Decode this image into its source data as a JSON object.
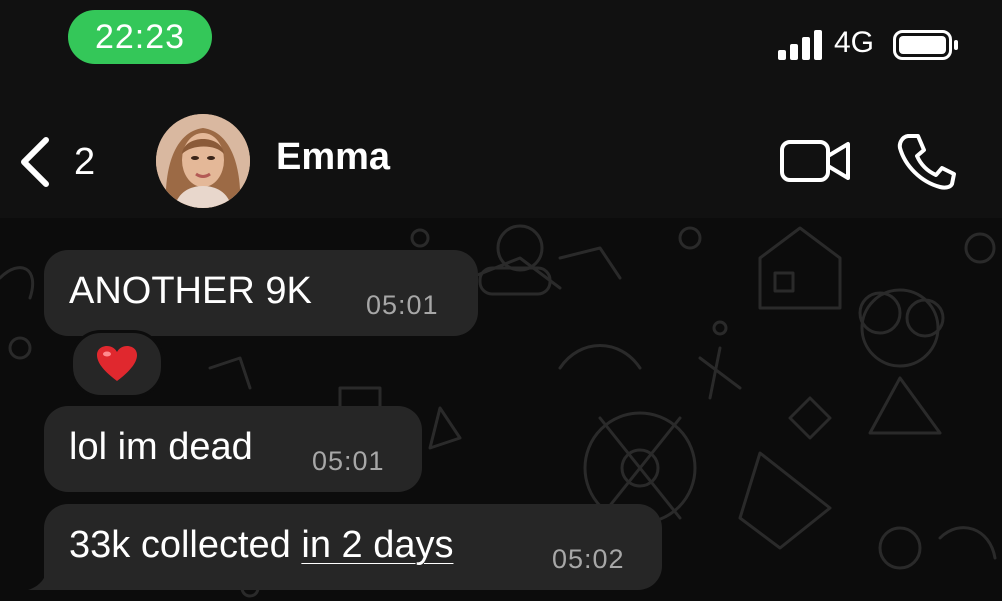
{
  "status_bar": {
    "time": "22:23",
    "network": "4G",
    "signal_bars": 4,
    "icons": [
      "signal-icon",
      "battery-icon"
    ],
    "pill_color": "#34c759"
  },
  "header": {
    "back_count": "2",
    "contact_name": "Emma",
    "icons": [
      "back-chevron-icon",
      "video-camera-icon",
      "phone-icon"
    ]
  },
  "messages": [
    {
      "text": "ANOTHER 9K",
      "time": "05:01",
      "reaction": "❤️"
    },
    {
      "text": "lol im dead",
      "time": "05:01"
    },
    {
      "text_prefix": "33k collected ",
      "link_text": "in 2 days",
      "time": "05:02"
    }
  ],
  "colors": {
    "background": "#0b0b0b",
    "bubble": "#262626",
    "accent": "#34c759"
  }
}
